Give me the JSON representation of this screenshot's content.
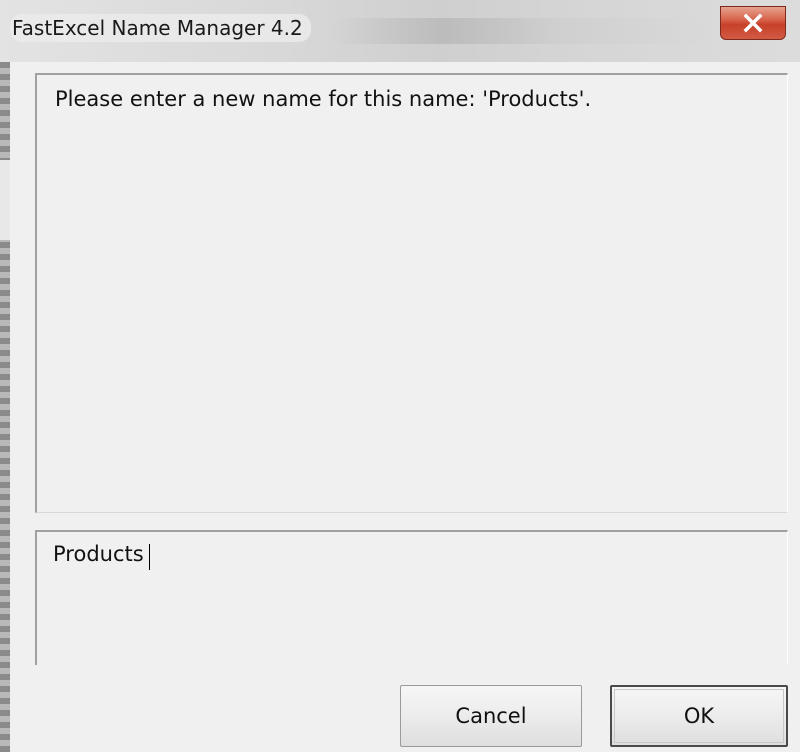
{
  "window": {
    "title": "FastExcel Name Manager 4.2",
    "close_icon": "close-x-icon"
  },
  "message": {
    "text": "Please enter a new name for this name: 'Products'."
  },
  "name_input": {
    "value": "Products",
    "placeholder": ""
  },
  "buttons": {
    "cancel_label": "Cancel",
    "ok_label": "OK"
  },
  "colors": {
    "close_button": "#c7402a",
    "window_bg": "#f0f0f0"
  }
}
